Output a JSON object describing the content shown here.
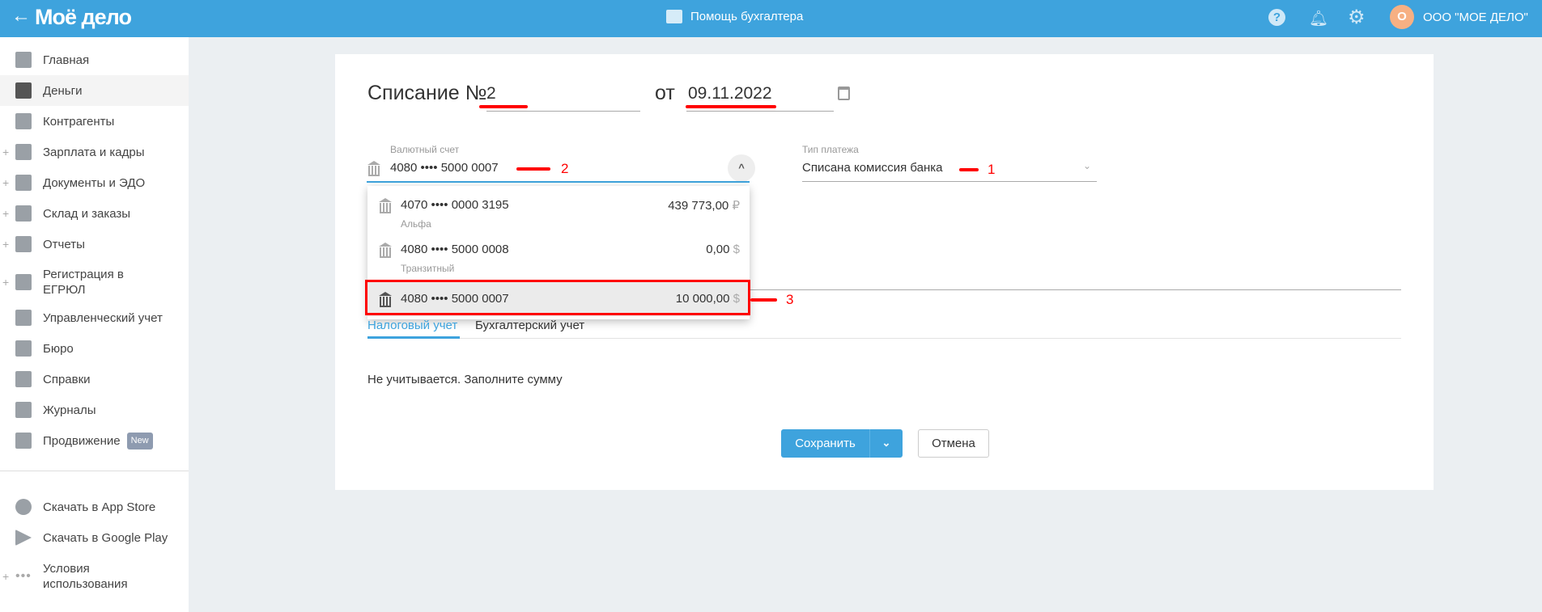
{
  "header": {
    "logo": "Moё дело",
    "back_icon": "arrow-left-icon",
    "center_title": "Помощь бухгалтера",
    "avatar_letter": "О",
    "company": "ООО \"МОЕ ДЕЛО\""
  },
  "sidebar": {
    "items": [
      {
        "label": "Главная",
        "icon": "home-icon",
        "expandable": false
      },
      {
        "label": "Деньги",
        "icon": "money-icon",
        "expandable": false,
        "active": true
      },
      {
        "label": "Контрагенты",
        "icon": "contractor-icon",
        "expandable": false
      },
      {
        "label": "Зарплата и кадры",
        "icon": "wallet-icon",
        "expandable": true
      },
      {
        "label": "Документы и ЭДО",
        "icon": "folder-icon",
        "expandable": true
      },
      {
        "label": "Склад и заказы",
        "icon": "warehouse-icon",
        "expandable": true
      },
      {
        "label": "Отчеты",
        "icon": "report-icon",
        "expandable": true
      },
      {
        "label": "Регистрация в ЕГРЮЛ",
        "icon": "registration-icon",
        "expandable": true
      },
      {
        "label": "Управленческий учет",
        "icon": "management-icon",
        "expandable": false
      },
      {
        "label": "Бюро",
        "icon": "briefcase-icon",
        "expandable": false
      },
      {
        "label": "Справки",
        "icon": "reference-icon",
        "expandable": false
      },
      {
        "label": "Журналы",
        "icon": "journal-icon",
        "expandable": false
      },
      {
        "label": "Продвижение",
        "icon": "promotion-icon",
        "expandable": false,
        "badge": "New"
      }
    ],
    "bottom_items": [
      {
        "label": "Скачать в App Store",
        "icon": "apple-icon"
      },
      {
        "label": "Скачать в Google Play",
        "icon": "google-play-icon"
      },
      {
        "label": "Условия использования",
        "icon": "more-icon"
      }
    ]
  },
  "form": {
    "title": "Списание №",
    "number": "2",
    "date_prefix": "от",
    "date": "09.11.2022",
    "account_label": "Валютный счет",
    "account_value": "4080 •••• 5000 0007",
    "payment_type_label": "Тип платежа",
    "payment_type_value": "Списана комиссия банка",
    "accounts": [
      {
        "number": "4070 •••• 0000 3195",
        "bank": "Альфа",
        "amount": "439 773,00",
        "currency": "₽"
      },
      {
        "number": "4080 •••• 5000 0008",
        "bank": "Транзитный",
        "amount": "0,00",
        "currency": "$"
      },
      {
        "number": "4080 •••• 5000 0007",
        "bank": "",
        "amount": "10 000,00",
        "currency": "$",
        "selected": true
      }
    ],
    "tabs": [
      "Налоговый учет",
      "Бухгалтерский учет"
    ],
    "tax_note": "Не учитывается. Заполните сумму",
    "save_label": "Сохранить",
    "cancel_label": "Отмена"
  },
  "annotations": [
    "2",
    "1",
    "3"
  ],
  "colors": {
    "header": "#3ea3dd",
    "accent": "#3ea3dd",
    "annotation": "#ff0000",
    "avatar": "#f7b083"
  }
}
